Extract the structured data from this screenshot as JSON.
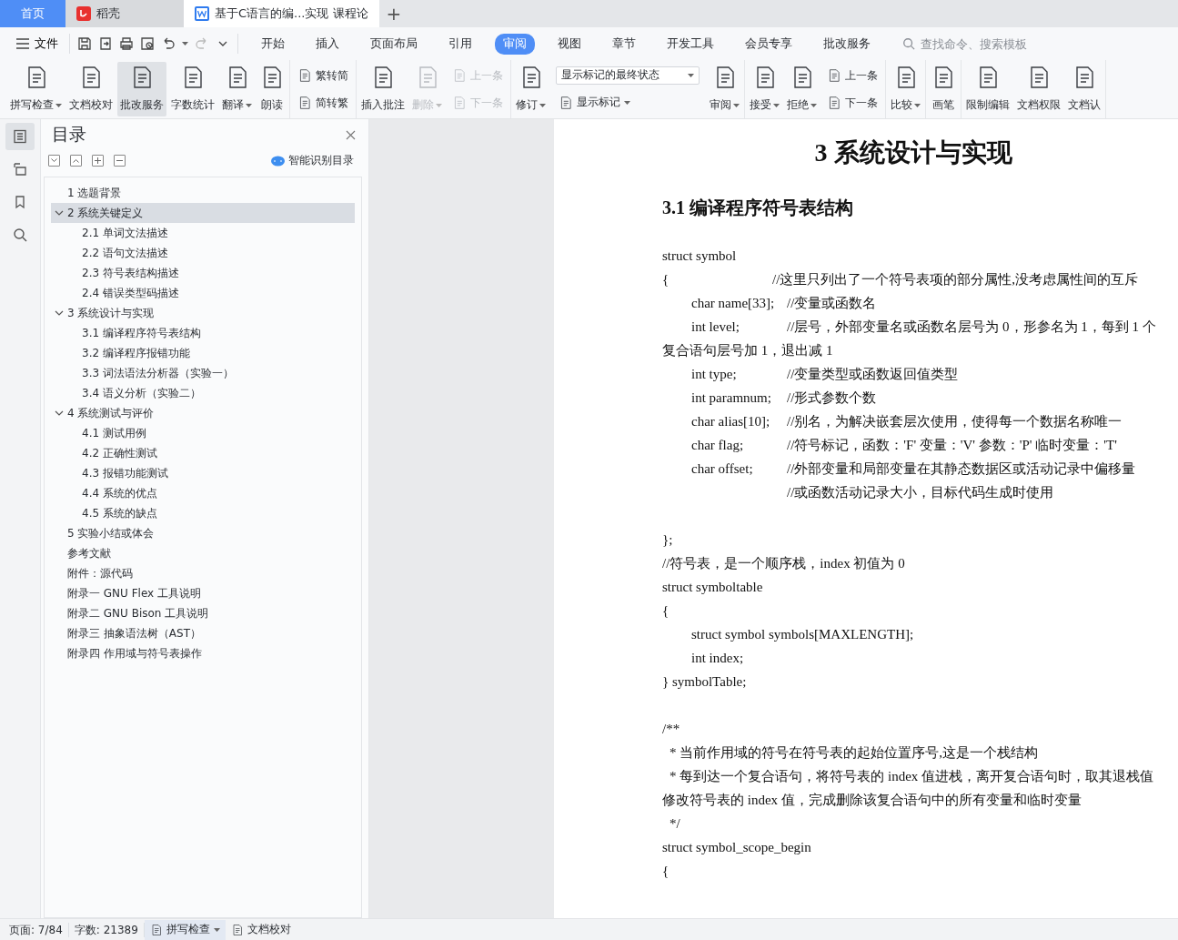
{
  "tabs": [
    {
      "kind": "home",
      "label": "首页",
      "selected": false
    },
    {
      "kind": "app",
      "label": "稻壳",
      "selected": false
    },
    {
      "kind": "document",
      "label": "基于C语言的编...实现 课程论",
      "selected": true
    }
  ],
  "new_tab": "+",
  "file_menu": "文件",
  "menu_tabs": [
    {
      "label": "开始",
      "selected": false
    },
    {
      "label": "插入",
      "selected": false
    },
    {
      "label": "页面布局",
      "selected": false
    },
    {
      "label": "引用",
      "selected": false
    },
    {
      "label": "审阅",
      "selected": true
    },
    {
      "label": "视图",
      "selected": false
    },
    {
      "label": "章节",
      "selected": false
    },
    {
      "label": "开发工具",
      "selected": false
    },
    {
      "label": "会员专享",
      "selected": false
    },
    {
      "label": "批改服务",
      "selected": false
    }
  ],
  "search": {
    "placeholder": "查找命令、搜索模板"
  },
  "ribbon": [
    [
      {
        "kind": "large",
        "label": "拼写检查",
        "caret": true,
        "disabled": false,
        "pressed": false
      },
      {
        "kind": "large",
        "label": "文档校对",
        "caret": false,
        "disabled": false,
        "pressed": false
      },
      {
        "kind": "large",
        "label": "批改服务",
        "caret": false,
        "disabled": false,
        "pressed": true
      },
      {
        "kind": "large",
        "label": "字数统计",
        "caret": false,
        "disabled": false,
        "pressed": false
      },
      {
        "kind": "large",
        "label": "翻译",
        "caret": true,
        "disabled": false,
        "pressed": false
      },
      {
        "kind": "large",
        "label": "朗读",
        "caret": false,
        "disabled": false,
        "pressed": false
      }
    ],
    [
      {
        "kind": "stack",
        "items": [
          {
            "label": "繁转简",
            "disabled": false
          },
          {
            "label": "简转繁",
            "disabled": false
          }
        ]
      }
    ],
    [
      {
        "kind": "large",
        "label": "插入批注",
        "caret": false,
        "disabled": false,
        "pressed": false
      },
      {
        "kind": "large",
        "label": "删除",
        "caret": true,
        "disabled": true,
        "pressed": false
      },
      {
        "kind": "stack",
        "items": [
          {
            "label": "上一条",
            "disabled": true
          },
          {
            "label": "下一条",
            "disabled": true
          }
        ]
      }
    ],
    [
      {
        "kind": "large",
        "label": "修订",
        "caret": true,
        "disabled": false,
        "pressed": false
      },
      {
        "kind": "select",
        "value": "显示标记的最终状态",
        "label": "显示标记"
      },
      {
        "kind": "large",
        "label": "审阅",
        "caret": true,
        "disabled": false,
        "pressed": false
      }
    ],
    [
      {
        "kind": "large",
        "label": "接受",
        "caret": true,
        "disabled": false,
        "pressed": false
      },
      {
        "kind": "large",
        "label": "拒绝",
        "caret": true,
        "disabled": false,
        "pressed": false
      },
      {
        "kind": "stack",
        "items": [
          {
            "label": "上一条",
            "disabled": false
          },
          {
            "label": "下一条",
            "disabled": false
          }
        ]
      }
    ],
    [
      {
        "kind": "large",
        "label": "比较",
        "caret": true,
        "disabled": false,
        "pressed": false
      }
    ],
    [
      {
        "kind": "large",
        "label": "画笔",
        "caret": false,
        "disabled": false,
        "pressed": false
      }
    ],
    [
      {
        "kind": "large",
        "label": "限制编辑",
        "caret": false,
        "disabled": false,
        "pressed": false
      },
      {
        "kind": "large",
        "label": "文档权限",
        "caret": false,
        "disabled": false,
        "pressed": false
      },
      {
        "kind": "large",
        "label": "文档认",
        "caret": false,
        "disabled": false,
        "pressed": false
      }
    ]
  ],
  "side_tools": [
    {
      "selected": true
    },
    {
      "selected": false
    },
    {
      "selected": false
    },
    {
      "selected": false
    }
  ],
  "toc": {
    "title": "目录",
    "smart_button": "智能识别目录",
    "items": [
      {
        "label": "1 选题背景",
        "selected": false
      },
      {
        "label": "2 系统关键定义",
        "selected": true,
        "expanded": true,
        "children": [
          {
            "label": "2.1 单词文法描述",
            "selected": false
          },
          {
            "label": "2.2 语句文法描述",
            "selected": false
          },
          {
            "label": "2.3  符号表结构描述",
            "selected": false
          },
          {
            "label": "2.4  错误类型码描述",
            "selected": false
          }
        ]
      },
      {
        "label": "3 系统设计与实现",
        "selected": false,
        "expanded": true,
        "children": [
          {
            "label": "3.1 编译程序符号表结构",
            "selected": false
          },
          {
            "label": "3.2 编译程序报错功能",
            "selected": false
          },
          {
            "label": "3.3 词法语法分析器（实验一）",
            "selected": false
          },
          {
            "label": "3.4 语义分析（实验二）",
            "selected": false
          }
        ]
      },
      {
        "label": "4 系统测试与评价",
        "selected": false,
        "expanded": true,
        "children": [
          {
            "label": "4.1  测试用例",
            "selected": false
          },
          {
            "label": "4.2  正确性测试",
            "selected": false
          },
          {
            "label": "4.3  报错功能测试",
            "selected": false
          },
          {
            "label": "4.4  系统的优点",
            "selected": false
          },
          {
            "label": "4.5  系统的缺点",
            "selected": false
          }
        ]
      },
      {
        "label": "5 实验小结或体会",
        "selected": false
      },
      {
        "label": "参考文献",
        "selected": false
      },
      {
        "label": "附件：源代码",
        "selected": false
      },
      {
        "label": "附录一  GNU Flex  工具说明",
        "selected": false
      },
      {
        "label": "附录二  GNU Bison  工具说明",
        "selected": false
      },
      {
        "label": "附录三  抽象语法树（AST）",
        "selected": false
      },
      {
        "label": "附录四  作用域与符号表操作",
        "selected": false
      }
    ]
  },
  "document": {
    "title": "3 系统设计与实现",
    "heading": "3.1 编译程序符号表结构",
    "lines": [
      {
        "kind": "plain",
        "code": "struct symbol"
      },
      {
        "kind": "plain",
        "code": "{",
        "comment": "//这里只列出了一个符号表项的部分属性,没考虑属性间的互斥"
      },
      {
        "kind": "indented",
        "code": "char name[33];",
        "comment": "//变量或函数名"
      },
      {
        "kind": "indented",
        "code": "int level;",
        "comment": "//层号，外部变量名或函数名层号为 0，形参名为 1，每到 1 个复合语句层号加 1，退出减 1"
      },
      {
        "kind": "indented",
        "code": "int type;",
        "comment": "//变量类型或函数返回值类型"
      },
      {
        "kind": "indented",
        "code": "int paramnum;",
        "comment": "//形式参数个数"
      },
      {
        "kind": "indented",
        "code": "char alias[10];",
        "comment": "//别名，为解决嵌套层次使用，使得每一个数据名称唯一"
      },
      {
        "kind": "indented",
        "code": "char flag;",
        "comment": "//符号标记，函数：'F'   变量：'V'    参数：'P'   临时变量：'T'"
      },
      {
        "kind": "indented",
        "code": "char offset;",
        "comment": "//外部变量和局部变量在其静态数据区或活动记录中偏移量"
      },
      {
        "kind": "indented",
        "comment": "//或函数活动记录大小，目标代码生成时使用"
      },
      {
        "kind": "gap"
      },
      {
        "kind": "plain",
        "code": "};"
      },
      {
        "kind": "plain",
        "code": "//符号表，是一个顺序栈，index 初值为 0"
      },
      {
        "kind": "plain",
        "code": "struct symboltable"
      },
      {
        "kind": "plain",
        "code": "{"
      },
      {
        "kind": "indented",
        "code": "struct symbol symbols[MAXLENGTH];"
      },
      {
        "kind": "indented",
        "code": "int index;"
      },
      {
        "kind": "plain",
        "code": "} symbolTable;"
      },
      {
        "kind": "gap"
      },
      {
        "kind": "plain",
        "code": "/**"
      },
      {
        "kind": "star",
        "code": "*  当前作用域的符号在符号表的起始位置序号,这是一个栈结构"
      },
      {
        "kind": "star",
        "code": "*  每到达一个复合语句，将符号表的 index 值进栈，离开复合语句时，取其退栈值修改符号表的 index 值，完成删除该复合语句中的所有变量和临时变量"
      },
      {
        "kind": "star",
        "code": "*/"
      },
      {
        "kind": "plain",
        "code": "struct symbol_scope_begin"
      },
      {
        "kind": "plain",
        "code": "{"
      }
    ]
  },
  "status_bar": [
    {
      "kind": "text",
      "label": "页面: 7/84"
    },
    {
      "kind": "text",
      "label": "字数: 21389"
    },
    {
      "kind": "button",
      "label": "拼写检查",
      "caret": true,
      "highlighted": true
    },
    {
      "kind": "button",
      "label": "文档校对",
      "caret": false,
      "highlighted": false
    }
  ]
}
